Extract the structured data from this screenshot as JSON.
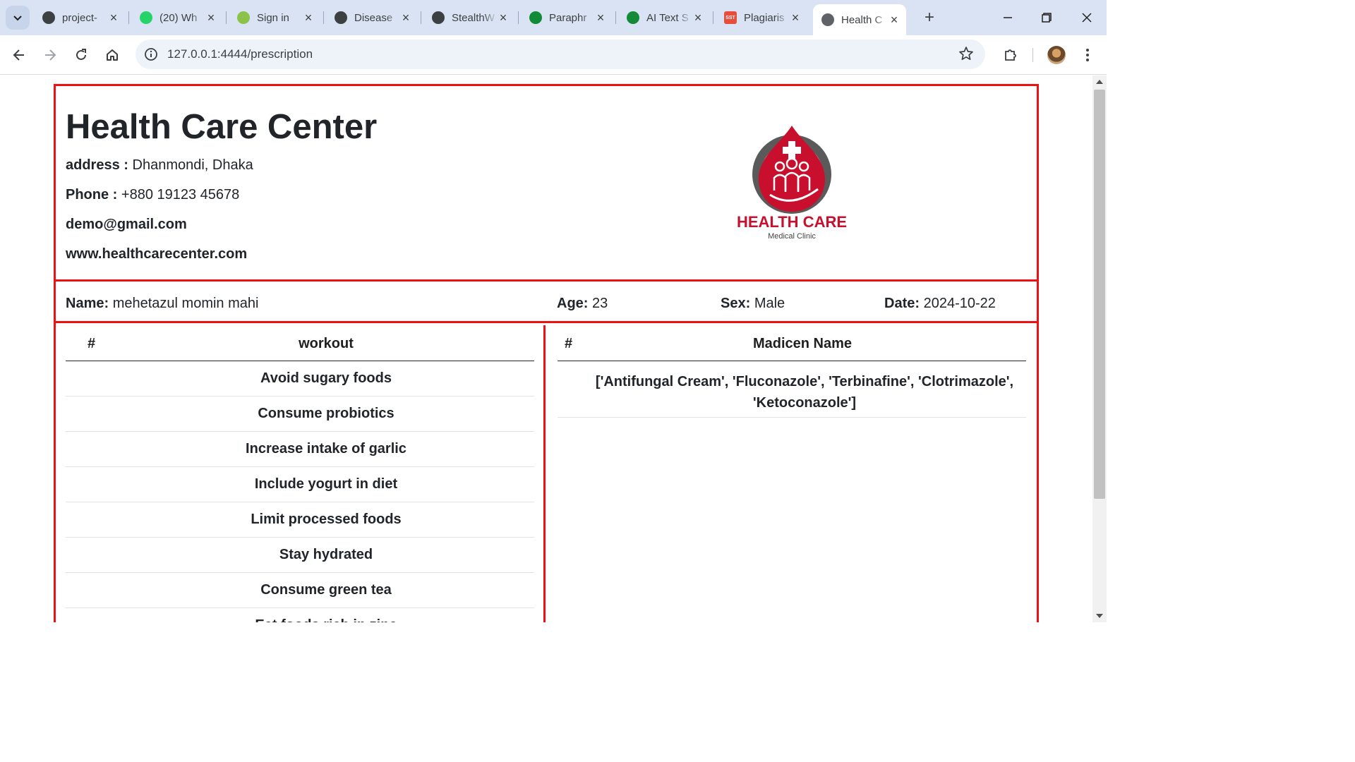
{
  "browser": {
    "tabs": [
      {
        "title": "project-",
        "icon": "project-icon",
        "color": "#3c4043"
      },
      {
        "title": "(20) Wh",
        "icon": "whatsapp-icon",
        "color": "#25d366"
      },
      {
        "title": "Sign in",
        "icon": "id-icon",
        "color": "#8bc34a"
      },
      {
        "title": "Disease",
        "icon": "openai-icon",
        "color": "#3c4043"
      },
      {
        "title": "StealthW",
        "icon": "brain-icon",
        "color": "#3c4043"
      },
      {
        "title": "Paraphr",
        "icon": "robot-icon",
        "color": "#138a36"
      },
      {
        "title": "AI Text S",
        "icon": "robot-icon",
        "color": "#138a36"
      },
      {
        "title": "Plagiaris",
        "icon": "sst-icon",
        "color": "#e74c3c",
        "fav_text": "SST"
      },
      {
        "title": "Health C",
        "icon": "globe-icon",
        "color": "#5f6368",
        "active": true
      }
    ],
    "url": "127.0.0.1:4444/prescription"
  },
  "clinic": {
    "title": "Health Care Center",
    "address_label": "address :",
    "address": "Dhanmondi, Dhaka",
    "phone_label": "Phone :",
    "phone": "+880 19123 45678",
    "email": "demo@gmail.com",
    "website": "www.healthcarecenter.com",
    "logo_text": "HEALTH CARE",
    "logo_sub": "Medical Clinic"
  },
  "patient": {
    "name_label": "Name:",
    "name": "mehetazul momin mahi",
    "age_label": "Age:",
    "age": "23",
    "sex_label": "Sex:",
    "sex": "Male",
    "date_label": "Date:",
    "date": "2024-10-22"
  },
  "workout_table": {
    "num_header": "#",
    "name_header": "workout",
    "rows": [
      "Avoid sugary foods",
      "Consume probiotics",
      "Increase intake of garlic",
      "Include yogurt in diet",
      "Limit processed foods",
      "Stay hydrated",
      "Consume green tea",
      "Eat foods rich in zinc"
    ]
  },
  "medicine_table": {
    "num_header": "#",
    "name_header": "Madicen Name",
    "rows": [
      "['Antifungal Cream', 'Fluconazole', 'Terbinafine', 'Clotrimazole', 'Ketoconazole']"
    ]
  },
  "colors": {
    "border": "#ee1111",
    "brand": "#c8102e",
    "chrome": "#dae3f3"
  }
}
